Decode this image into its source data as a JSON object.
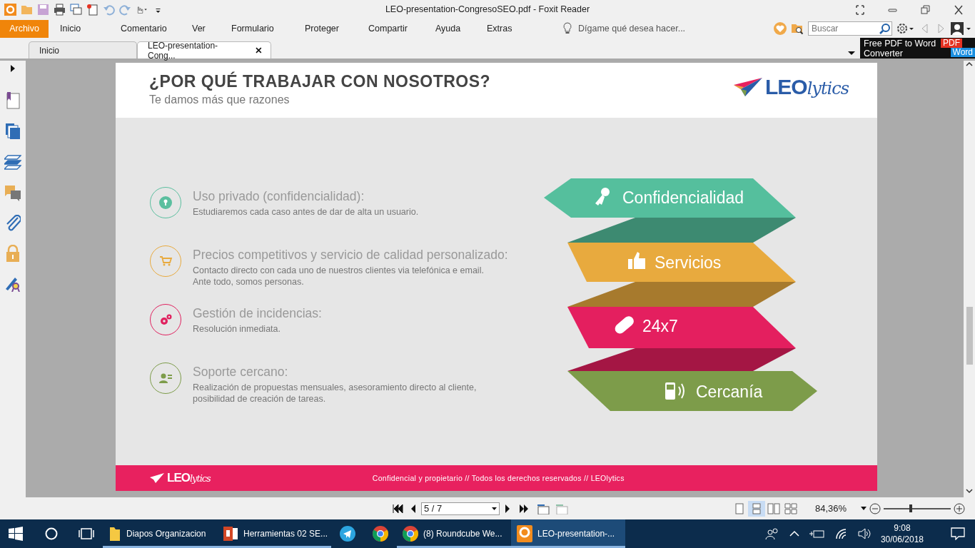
{
  "window": {
    "title": "LEO-presentation-CongresoSEO.pdf - Foxit Reader"
  },
  "menu": [
    {
      "label": "Archivo",
      "kind": "file"
    },
    {
      "label": "Inicio",
      "kind": "tab"
    },
    {
      "label": "Comentario",
      "kind": "tab"
    },
    {
      "label": "Ver",
      "kind": "tab"
    },
    {
      "label": "Formulario",
      "kind": "tab"
    },
    {
      "label": "Proteger",
      "kind": "tab"
    },
    {
      "label": "Compartir",
      "kind": "tab"
    },
    {
      "label": "Ayuda",
      "kind": "tab"
    },
    {
      "label": "Extras",
      "kind": "tab"
    }
  ],
  "tell_me": {
    "placeholder": "Dígame qué desea hacer..."
  },
  "search": {
    "placeholder": "Buscar"
  },
  "doc_tabs": [
    {
      "label": "Inicio",
      "selected": false
    },
    {
      "label": "LEO-presentation-Cong...",
      "selected": true
    }
  ],
  "ad": {
    "lines": [
      "Free PDF to Word",
      "Converter"
    ],
    "badges": [
      "PDF",
      "Word"
    ]
  },
  "slide": {
    "title": "¿POR QUÉ TRABAJAR CON NOSOTROS?",
    "subtitle": "Te damos más que razones",
    "logo": {
      "main": "LEO",
      "script": "lytics"
    },
    "features": [
      {
        "kind": "lock",
        "color": "#5bbf9f",
        "title": "Uso privado (confidencialidad):",
        "description": [
          "Estudiaremos cada caso antes de dar de alta un usuario."
        ]
      },
      {
        "kind": "cart",
        "color": "#e8aa3e",
        "title": "Precios competitivos y servicio de calidad personalizado:",
        "description": [
          "Contacto directo con cada uno de nuestros clientes via telefónica e email.",
          "Ante todo, somos personas."
        ]
      },
      {
        "kind": "gears",
        "color": "#e0215f",
        "title": "Gestión de incidencias:",
        "description": [
          "Resolución inmediata."
        ]
      },
      {
        "kind": "contact",
        "color": "#7d9c4a",
        "title": "Soporte cercano:",
        "description": [
          "Realización de propuestas mensuales, asesoramiento directo al cliente,",
          "posibilidad de creación de tareas."
        ]
      }
    ],
    "banners": [
      {
        "label": "Confidencialidad",
        "kind": "key",
        "color": "#55bf9d"
      },
      {
        "label": "Servicios",
        "kind": "thumb",
        "color": "#e8aa3e"
      },
      {
        "label": "24x7",
        "kind": "bandage",
        "color": "#e41f5f"
      },
      {
        "label": "Cercanía",
        "kind": "phone",
        "color": "#7d9c4a"
      }
    ],
    "footer": {
      "logo": {
        "main": "LEO",
        "script": "lytics"
      },
      "text": "Confidencial y propietario // Todos los derechos reservados // LEOlytics"
    }
  },
  "nav": {
    "page": "5 / 7",
    "zoom": "84,36%",
    "zoom_slider": {
      "level": 0.38
    },
    "view_modes": [
      {
        "kind": "single",
        "selected": false
      },
      {
        "kind": "continuous",
        "selected": true
      },
      {
        "kind": "facing",
        "selected": false
      },
      {
        "kind": "facing-continuous",
        "selected": false
      }
    ]
  },
  "taskbar": {
    "items": [
      {
        "kind": "folder",
        "label": "Diapos Organizacion",
        "running": true,
        "selected": false
      },
      {
        "kind": "powerpoint",
        "label": "Herramientas 02 SE...",
        "running": true,
        "selected": false
      },
      {
        "kind": "telegram",
        "running": false,
        "selected": false
      },
      {
        "kind": "chrome",
        "running": false,
        "selected": false
      },
      {
        "kind": "chrome",
        "label": "(8) Roundcube We...",
        "running": true,
        "selected": false
      },
      {
        "kind": "foxit",
        "label": "LEO-presentation-...",
        "running": true,
        "selected": true
      }
    ],
    "time": "9:08",
    "date": "30/06/2018"
  }
}
